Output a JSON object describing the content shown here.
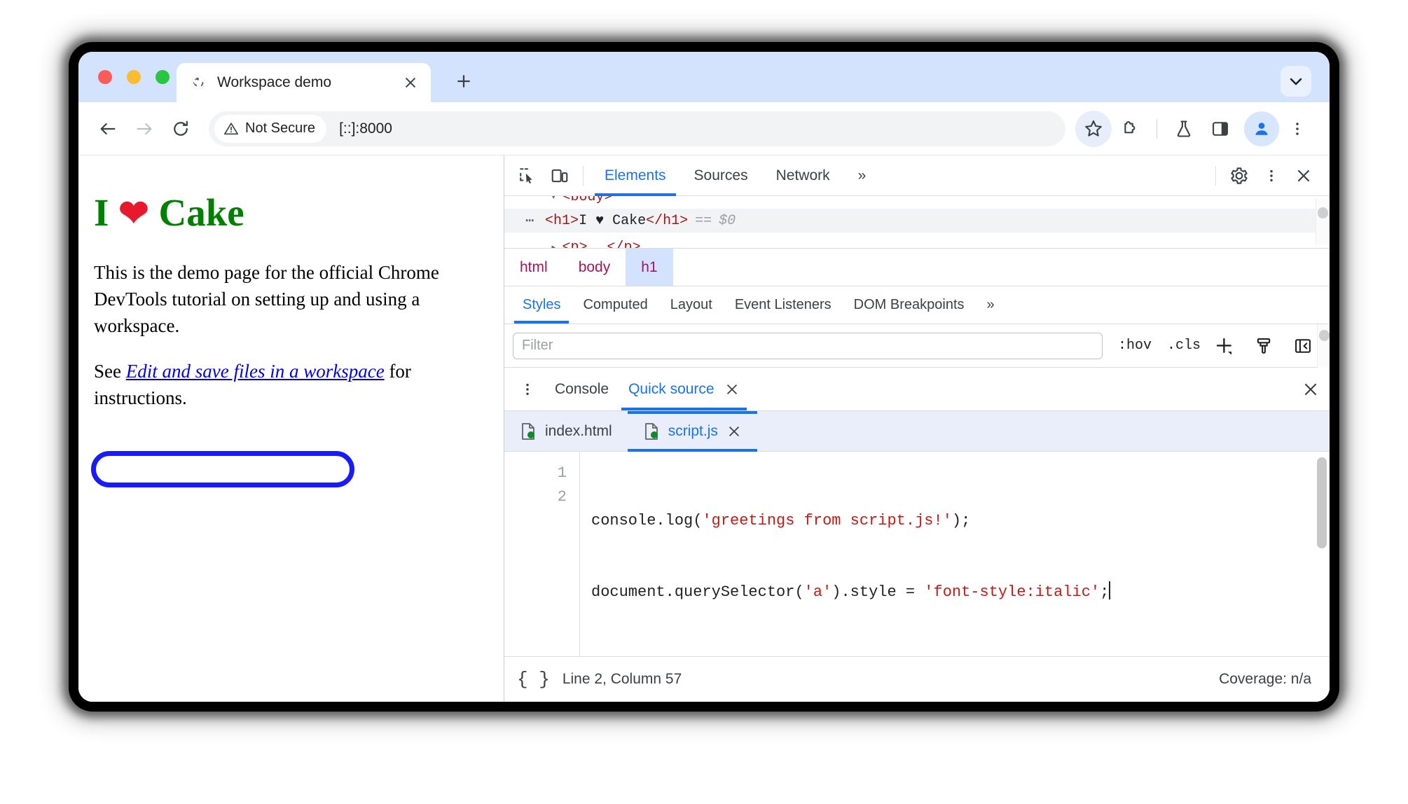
{
  "browser": {
    "tab": {
      "title": "Workspace demo",
      "favicon": "globe-icon",
      "close": "✕"
    },
    "new_tab_label": "+",
    "tab_search": "chevron-down-icon",
    "toolbar": {
      "back": "arrow-left-icon",
      "forward": "arrow-right-icon",
      "reload": "reload-icon",
      "security_badge": "Not Secure",
      "security_icon": "warning-triangle-icon",
      "url": "[::]:8000",
      "bookmark": "star-icon",
      "extensions": "puzzle-piece-icon",
      "labs": "flask-icon",
      "side_panel": "side-panel-icon",
      "profile": "avatar-icon",
      "menu": "three-dot-menu-icon"
    }
  },
  "page": {
    "heading_pre": "I ",
    "heading_heart": "❤",
    "heading_post": " Cake",
    "paragraph1": "This is the demo page for the official Chrome DevTools tutorial on setting up and using a workspace.",
    "paragraph2_pre": "See ",
    "link_text": "Edit and save files in a workspace",
    "paragraph2_post": " for instructions.",
    "colors": {
      "heading": "#008000",
      "heart": "#e8192c",
      "link": "#0000ee",
      "annotation": "#1a1aff"
    }
  },
  "devtools": {
    "toolbar": {
      "inspect": "inspect-element-icon",
      "device": "device-toolbar-icon",
      "tabs": [
        {
          "label": "Elements",
          "active": true
        },
        {
          "label": "Sources",
          "active": false
        },
        {
          "label": "Network",
          "active": false
        }
      ],
      "overflow": "»",
      "settings": "gear-icon",
      "more": "three-dot-menu-icon",
      "close": "close-icon"
    },
    "dom": {
      "row_body": "<body>",
      "row_h1_open": "<h1>",
      "row_h1_text": "I ♥ Cake",
      "row_h1_close": "</h1>",
      "row_h1_eq": "==",
      "row_h1_ref": "$0",
      "row_p_open": "<p>",
      "row_p_close": "</p>",
      "ellipsis": "⋯"
    },
    "breadcrumb": [
      {
        "label": "html",
        "selected": false
      },
      {
        "label": "body",
        "selected": false
      },
      {
        "label": "h1",
        "selected": true
      }
    ],
    "styles_tabs": [
      {
        "label": "Styles",
        "active": true
      },
      {
        "label": "Computed",
        "active": false
      },
      {
        "label": "Layout",
        "active": false
      },
      {
        "label": "Event Listeners",
        "active": false
      },
      {
        "label": "DOM Breakpoints",
        "active": false
      }
    ],
    "styles_overflow": "»",
    "filter": {
      "placeholder": "Filter",
      "value": "",
      "hov": ":hov",
      "cls": ".cls",
      "new_rule": "plus-icon",
      "compute": "paint-brush-icon",
      "sidebar_toggle": "sidebar-toggle-icon"
    },
    "drawer": {
      "menu": "three-dot-menu-icon",
      "tabs": [
        {
          "label": "Console",
          "active": false,
          "closable": false
        },
        {
          "label": "Quick source",
          "active": true,
          "closable": true
        }
      ],
      "tab_close": "✕",
      "close": "✕"
    },
    "files": [
      {
        "name": "index.html",
        "active": false,
        "closable": false,
        "icon": "file-mapped-icon"
      },
      {
        "name": "script.js",
        "active": true,
        "closable": true,
        "icon": "file-mapped-icon"
      }
    ],
    "file_close": "✕",
    "editor": {
      "lines": [
        {
          "num": "1",
          "segments": [
            {
              "t": "console.log(",
              "c": "plain"
            },
            {
              "t": "'greetings from script.js!'",
              "c": "string"
            },
            {
              "t": ");",
              "c": "plain"
            }
          ]
        },
        {
          "num": "2",
          "segments": [
            {
              "t": "document.querySelector(",
              "c": "plain"
            },
            {
              "t": "'a'",
              "c": "string"
            },
            {
              "t": ").style = ",
              "c": "plain"
            },
            {
              "t": "'font-style:italic'",
              "c": "string"
            },
            {
              "t": ";",
              "c": "plain"
            }
          ]
        }
      ]
    },
    "status": {
      "format_icon": "{ }",
      "position": "Line 2, Column 57",
      "coverage": "Coverage: n/a"
    }
  }
}
